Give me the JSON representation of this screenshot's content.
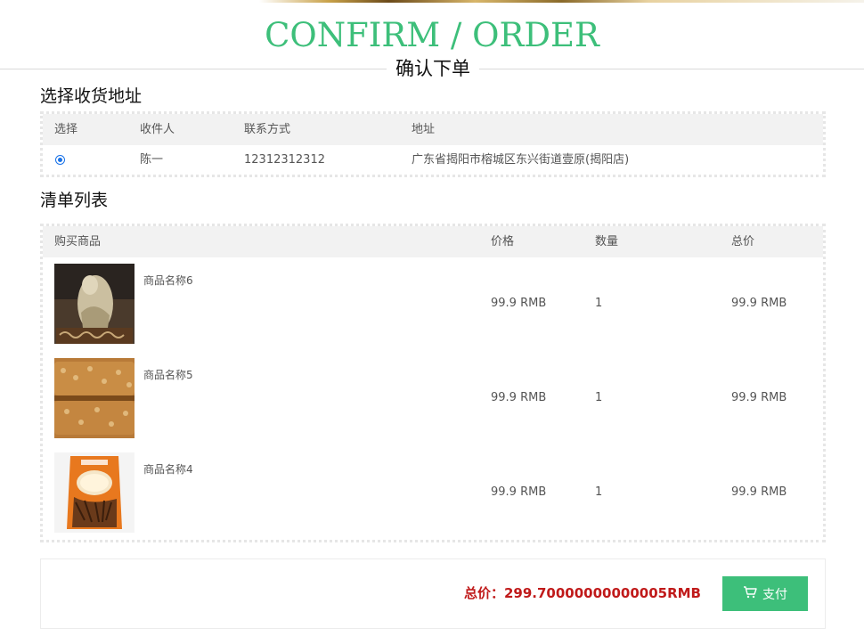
{
  "header": {
    "title": "CONFIRM / ORDER",
    "subtitle": "确认下单"
  },
  "address_section": {
    "title": "选择收货地址",
    "columns": [
      "选择",
      "收件人",
      "联系方式",
      "地址"
    ],
    "rows": [
      {
        "selected": true,
        "name": "陈一",
        "phone": "12312312312",
        "address": "广东省揭阳市榕城区东兴街道壹原(揭阳店)"
      }
    ]
  },
  "order_section": {
    "title": "清单列表",
    "columns": [
      "购买商品",
      "价格",
      "数量",
      "总价"
    ],
    "items": [
      {
        "name": "商品名称6",
        "price": "99.9 RMB",
        "quantity": "1",
        "total": "99.9 RMB",
        "image": "carved-stone-sculpture"
      },
      {
        "name": "商品名称5",
        "price": "99.9 RMB",
        "quantity": "1",
        "total": "99.9 RMB",
        "image": "peanut-brittle-candy"
      },
      {
        "name": "商品名称4",
        "price": "99.9 RMB",
        "quantity": "1",
        "total": "99.9 RMB",
        "image": "packaged-dried-lily-flowers"
      }
    ]
  },
  "summary": {
    "total_label": "总价：",
    "total_value": "299.70000000000005RMB",
    "pay_label": "支付",
    "pay_icon": "cart-icon"
  },
  "colors": {
    "accent": "#3dbf7a",
    "price": "#c01a1a"
  }
}
